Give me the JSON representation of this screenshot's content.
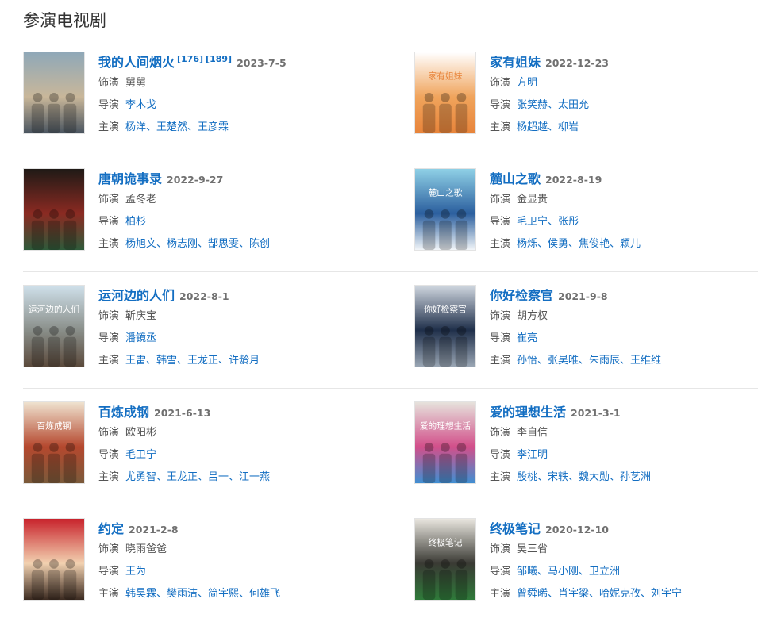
{
  "section": {
    "title": "参演电视剧"
  },
  "shows": [
    {
      "title": "我的人间烟火",
      "refs": [
        "[176]",
        "[189]"
      ],
      "date": "2023-7-5",
      "role_label": "饰演",
      "role": "舅舅",
      "role_link": false,
      "director_label": "导演",
      "directors": "李木戈",
      "cast_label": "主演",
      "cast": "杨洋、王楚然、王彦霖",
      "poster_text": "",
      "poster_colors": [
        "#8fa8b8",
        "#c9b79a",
        "#4a5560"
      ]
    },
    {
      "title": "家有姐妹",
      "refs": [],
      "date": "2022-12-23",
      "role_label": "饰演",
      "role": "方明",
      "role_link": true,
      "director_label": "导演",
      "directors": "张笑赫、太田允",
      "cast_label": "主演",
      "cast": "杨超越、柳岩",
      "poster_text": "家有姐妹",
      "poster_colors": [
        "#ffffff",
        "#f0a45c",
        "#e8843a"
      ]
    },
    {
      "title": "唐朝诡事录",
      "refs": [],
      "date": "2022-9-27",
      "role_label": "饰演",
      "role": "孟冬老",
      "role_link": false,
      "director_label": "导演",
      "directors": "柏杉",
      "cast_label": "主演",
      "cast": "杨旭文、杨志刚、郜思雯、陈创",
      "poster_text": "",
      "poster_colors": [
        "#1f1a16",
        "#8b2a22",
        "#2e5a3a"
      ]
    },
    {
      "title": "麓山之歌",
      "refs": [],
      "date": "2022-8-19",
      "role_label": "饰演",
      "role": "金显贵",
      "role_link": false,
      "director_label": "导演",
      "directors": "毛卫宁、张彤",
      "cast_label": "主演",
      "cast": "杨烁、侯勇、焦俊艳、颖儿",
      "poster_text": "麓山之歌",
      "poster_colors": [
        "#8fd0e6",
        "#2b5f9e",
        "#f2f6f9"
      ]
    },
    {
      "title": "运河边的人们",
      "refs": [],
      "date": "2022-8-1",
      "role_label": "饰演",
      "role": "靳庆宝",
      "role_link": false,
      "director_label": "导演",
      "directors": "潘镜丞",
      "cast_label": "主演",
      "cast": "王雷、韩雪、王龙正、许龄月",
      "poster_text": "运河边的人们",
      "poster_colors": [
        "#cfe0ea",
        "#8a8f8a",
        "#5b4a3c"
      ]
    },
    {
      "title": "你好检察官",
      "refs": [],
      "date": "2021-9-8",
      "role_label": "饰演",
      "role": "胡方权",
      "role_link": false,
      "director_label": "导演",
      "directors": "崔亮",
      "cast_label": "主演",
      "cast": "孙怡、张昊唯、朱雨辰、王维维",
      "poster_text": "你好检察官",
      "poster_colors": [
        "#cfd6df",
        "#1f2f4a",
        "#9aa6b4"
      ]
    },
    {
      "title": "百炼成钢",
      "refs": [],
      "date": "2021-6-13",
      "role_label": "饰演",
      "role": "欧阳彬",
      "role_link": false,
      "director_label": "导演",
      "directors": "毛卫宁",
      "cast_label": "主演",
      "cast": "尤勇智、王龙正、吕一、江一燕",
      "poster_text": "百炼成钢",
      "poster_colors": [
        "#efe2cf",
        "#b5482e",
        "#7a5a3a"
      ]
    },
    {
      "title": "爱的理想生活",
      "refs": [],
      "date": "2021-3-1",
      "role_label": "饰演",
      "role": "李自信",
      "role_link": false,
      "director_label": "导演",
      "directors": "李江明",
      "cast_label": "主演",
      "cast": "殷桃、宋轶、魏大勋、孙艺洲",
      "poster_text": "爱的理想生活",
      "poster_colors": [
        "#e6e2dc",
        "#d24f8a",
        "#3f8fd2"
      ]
    },
    {
      "title": "约定",
      "refs": [],
      "date": "2021-2-8",
      "role_label": "饰演",
      "role": "晓雨爸爸",
      "role_link": false,
      "director_label": "导演",
      "directors": "王为",
      "cast_label": "主演",
      "cast": "韩昊霖、樊雨洁、简宇熙、何雄飞",
      "poster_text": "",
      "poster_colors": [
        "#c8232c",
        "#f2d1b0",
        "#3b2a20"
      ]
    },
    {
      "title": "终极笔记",
      "refs": [],
      "date": "2020-12-10",
      "role_label": "饰演",
      "role": "吴三省",
      "role_link": false,
      "director_label": "导演",
      "directors": "邹曦、马小刚、卫立洲",
      "cast_label": "主演",
      "cast": "曾舜晞、肖宇梁、哈妮克孜、刘宇宁",
      "poster_text": "终极笔记",
      "poster_colors": [
        "#e9e6df",
        "#3a3a34",
        "#2f7a3a"
      ]
    }
  ]
}
